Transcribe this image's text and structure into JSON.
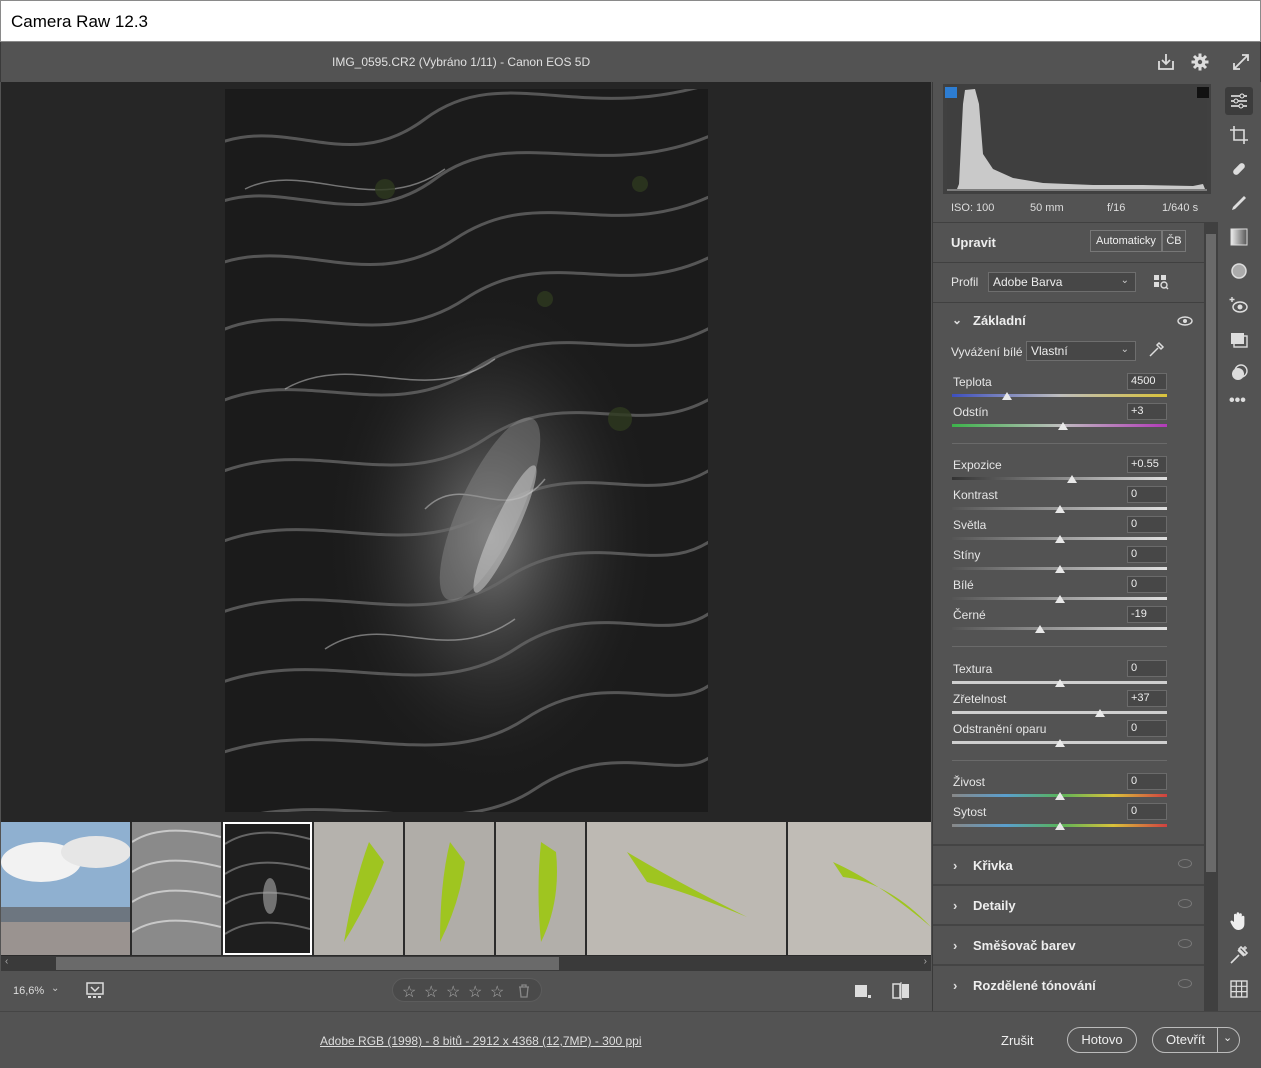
{
  "window": {
    "title": "Camera Raw 12.3"
  },
  "topbar": {
    "filename": "IMG_0595.CR2 (Vybráno 1/11)  -  Canon EOS 5D"
  },
  "exif": {
    "iso": "ISO: 100",
    "focal": "50 mm",
    "aperture": "f/16",
    "shutter": "1/640 s"
  },
  "edit": {
    "title": "Upravit",
    "auto": "Automaticky",
    "bw": "ČB"
  },
  "profile": {
    "label": "Profil",
    "value": "Adobe Barva"
  },
  "basic": {
    "title": "Základní",
    "wb_label": "Vyvážení bílé",
    "wb_value": "Vlastní",
    "sliders": [
      {
        "label": "Teplota",
        "value": "4500"
      },
      {
        "label": "Odstín",
        "value": "+3"
      },
      {
        "label": "Expozice",
        "value": "+0.55"
      },
      {
        "label": "Kontrast",
        "value": "0"
      },
      {
        "label": "Světla",
        "value": "0"
      },
      {
        "label": "Stíny",
        "value": "0"
      },
      {
        "label": "Bílé",
        "value": "0"
      },
      {
        "label": "Černé",
        "value": "-19"
      },
      {
        "label": "Textura",
        "value": "0"
      },
      {
        "label": "Zřetelnost",
        "value": "+37"
      },
      {
        "label": "Odstranění oparu",
        "value": "0"
      },
      {
        "label": "Živost",
        "value": "0"
      },
      {
        "label": "Sytost",
        "value": "0"
      }
    ]
  },
  "sections": [
    {
      "label": "Křivka"
    },
    {
      "label": "Detaily"
    },
    {
      "label": "Směšovač barev"
    },
    {
      "label": "Rozdělené tónování"
    }
  ],
  "zoom": {
    "value": "16,6%"
  },
  "footer": {
    "info": "Adobe RGB (1998) - 8 bitů - 2912 x 4368 (12,7MP) - 300 ppi",
    "cancel": "Zrušit",
    "done": "Hotovo",
    "open": "Otevřít"
  },
  "colors": {
    "bg": "#535353",
    "workspace": "#262626",
    "accent": "#2d7dd2"
  }
}
